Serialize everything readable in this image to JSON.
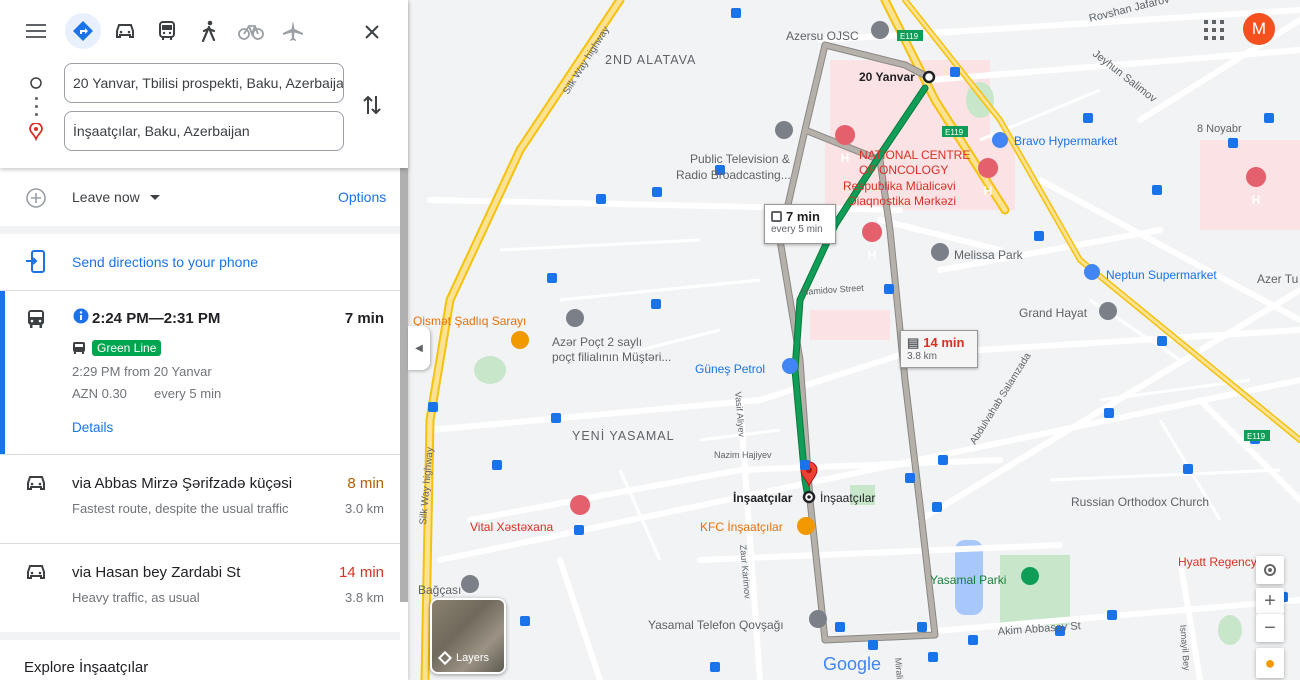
{
  "header": {
    "modes": [
      "best-route",
      "driving",
      "transit",
      "walking",
      "cycling",
      "flights"
    ],
    "from_value": "20 Yanvar, Tbilisi prospekti, Baku, Azerbaijan",
    "to_value": "İnşaatçılar, Baku, Azerbaijan"
  },
  "options_bar": {
    "leave_label": "Leave now",
    "options_label": "Options"
  },
  "send_label": "Send directions to your phone",
  "transit_route": {
    "times": "2:24 PM—2:31 PM",
    "duration": "7 min",
    "line": "Green Line",
    "from": "2:29 PM from 20 Yanvar",
    "fare": "AZN 0.30",
    "frequency": "every 5 min",
    "details_label": "Details"
  },
  "drive_routes": [
    {
      "via": "via Abbas Mirzə Şərifzadə küçəsi",
      "time": "8 min",
      "note": "Fastest route, despite the usual traffic",
      "dist": "3.0 km",
      "time_color": "#b06000"
    },
    {
      "via": "via Hasan bey Zardabi St",
      "time": "14 min",
      "note": "Heavy traffic, as usual",
      "dist": "3.8 km",
      "time_color": "#d93025"
    }
  ],
  "explore_label": "Explore İnşaatçılar",
  "map": {
    "avatar_letter": "M",
    "layers_label": "Layers",
    "google_label": "Google",
    "bubble_transit_time": "7 min",
    "bubble_transit_freq": "every 5 min",
    "bubble_drive_time": "14 min",
    "bubble_drive_dist": "3.8 km",
    "labels": {
      "azersu": "Azersu OJSC",
      "alatava": "2ND ALATAVA",
      "yanvar": "20 Yanvar",
      "rovshan": "Rovshan Jafarov",
      "jeyhun": "Jeyhun Salimov",
      "novabr": "8 Noyabr",
      "bravo": "Bravo Hypermarket",
      "oncology1": "NATIONAL CENTRE",
      "oncology2": "OF ONCOLOGY",
      "respublika1": "Respublika Müalicəvi",
      "respublika2": "Diaqnostika Mərkəzi",
      "ptv1": "Public Television &",
      "ptv2": "Radio Broadcasting...",
      "melissa": "Melissa Park",
      "neptun": "Neptun Supermarket",
      "azer_t": "Azer Tu",
      "hamidov": "Hamidov Street",
      "qismet": "Qismət Şadlıq Sarayı",
      "azerpoct1": "Azər Poçt 2 saylı",
      "azerpoct2": "poçt filialının Müştəri...",
      "gunes": "Güneş Petrol",
      "grand": "Grand Hayat",
      "salamzada": "Abdulvahab Salamzada",
      "yasamal": "YENİ YASAMAL",
      "vasif": "Vasif Aliyev",
      "nazim": "Nazim Hajiyev",
      "insaatcilar": "İnşaatçılar",
      "insaatcilar2": "İnşaatçılar",
      "vital": "Vital Xəstəxana",
      "kfc": "KFC İnşaatçılar",
      "zaur": "Zaur Karimov",
      "russian": "Russian Orthodox Church",
      "hyatt": "Hyatt Regency",
      "yasamal_park": "Yasamal Parki",
      "akim": "Akim Abbasov St",
      "telefon": "Yasamal Telefon Qovşağı",
      "bagcasi": "Bağçası",
      "silkway1": "Silk Way highway",
      "silkway2": "Silk Way highway",
      "mirali": "Mirali",
      "ismayil": "Ismayil Bey",
      "shields": [
        "E119",
        "E119",
        "E119"
      ]
    }
  },
  "colors": {
    "accent": "#1a73e8",
    "transit_green": "#0f9d58",
    "route_grey": "#a5a09b"
  }
}
